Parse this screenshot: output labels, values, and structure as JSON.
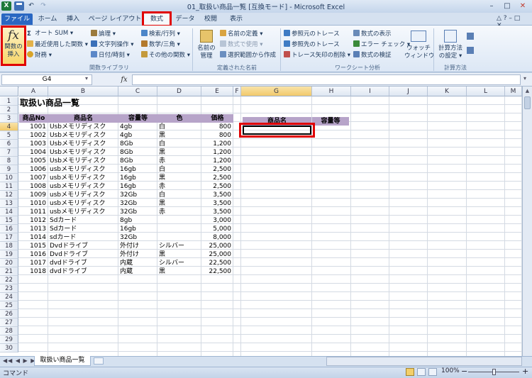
{
  "window": {
    "title": "01_取扱い商品一覧 [互換モード] - Microsoft Excel",
    "app_icon": "X",
    "undo": "↶",
    "redo": "↷"
  },
  "tabs": [
    "ファイル",
    "ホーム",
    "挿入",
    "ページ レイアウト",
    "数式",
    "データ",
    "校閲",
    "表示"
  ],
  "ribbon": {
    "insert_function": {
      "symbol": "fx",
      "line1": "関数の",
      "line2": "挿入"
    },
    "library": [
      "オート SUM",
      "最近使用した関数",
      "財務",
      "論理",
      "文字列操作",
      "日付/時刻",
      "検索/行列",
      "数学/三角",
      "その他の関数"
    ],
    "library_label": "関数ライブラリ",
    "name_manager": {
      "line1": "名前の",
      "line2": "管理"
    },
    "defined": [
      "名前の定義",
      "数式で使用",
      "選択範囲から作成"
    ],
    "defined_label": "定義された名前",
    "audit": [
      "参照元のトレース",
      "参照先のトレース",
      "トレース矢印の削除",
      "数式の表示",
      "エラー チェック",
      "数式の検証"
    ],
    "watch": {
      "line1": "ウォッチ",
      "line2": "ウィンドウ"
    },
    "audit_label": "ワークシート分析",
    "calc": {
      "line1": "計算方法",
      "line2": "の設定"
    },
    "calc_label": "計算方法"
  },
  "formula_bar": {
    "name_box": "G4",
    "fx": "fx",
    "value": ""
  },
  "columns": [
    "A",
    "B",
    "C",
    "D",
    "E",
    "F",
    "G",
    "H",
    "I",
    "J",
    "K",
    "L",
    "M"
  ],
  "rows": [
    "1",
    "2",
    "3",
    "4",
    "5",
    "6",
    "7",
    "8",
    "9",
    "10",
    "11",
    "12",
    "13",
    "14",
    "15",
    "16",
    "17",
    "18",
    "19",
    "20",
    "21",
    "22",
    "23",
    "24",
    "25",
    "26",
    "27",
    "28",
    "29",
    "30"
  ],
  "sheet": {
    "title": "取扱い商品一覧",
    "headers": [
      "商品No",
      "商品名",
      "容量等",
      "色",
      "価格"
    ],
    "lookup_headers": [
      "商品名",
      "容量等"
    ],
    "products": [
      [
        "1001",
        "Usbメモリディスク",
        "4gb",
        "白",
        "800"
      ],
      [
        "1002",
        "Usbメモリディスク",
        "4gb",
        "黒",
        "800"
      ],
      [
        "1003",
        "Usbメモリディスク",
        "8Gb",
        "白",
        "1,200"
      ],
      [
        "1004",
        "Usbメモリディスク",
        "8Gb",
        "黒",
        "1,200"
      ],
      [
        "1005",
        "Usbメモリディスク",
        "8Gb",
        "赤",
        "1,200"
      ],
      [
        "1006",
        "usbメモリディスク",
        "16gb",
        "白",
        "2,500"
      ],
      [
        "1007",
        "usbメモリディスク",
        "16gb",
        "黒",
        "2,500"
      ],
      [
        "1008",
        "usbメモリディスク",
        "16gb",
        "赤",
        "2,500"
      ],
      [
        "1009",
        "usbメモリディスク",
        "32Gb",
        "白",
        "3,500"
      ],
      [
        "1010",
        "usbメモリディスク",
        "32Gb",
        "黒",
        "3,500"
      ],
      [
        "1011",
        "usbメモリディスク",
        "32Gb",
        "赤",
        "3,500"
      ],
      [
        "1012",
        "Sdカード",
        "8gb",
        "",
        "3,000"
      ],
      [
        "1013",
        "Sdカード",
        "16gb",
        "",
        "5,000"
      ],
      [
        "1014",
        "sdカード",
        "32Gb",
        "",
        "8,000"
      ],
      [
        "1015",
        "Dvdドライブ",
        "外付け",
        "シルバー",
        "25,000"
      ],
      [
        "1016",
        "Dvdドライブ",
        "外付け",
        "黒",
        "25,000"
      ],
      [
        "1017",
        "dvdドライブ",
        "内蔵",
        "シルバー",
        "22,500"
      ],
      [
        "1018",
        "dvdドライブ",
        "内蔵",
        "黒",
        "22,500"
      ]
    ]
  },
  "sheet_tab": "取扱い商品一覧",
  "status": {
    "mode": "コマンド",
    "zoom": "100%",
    "minus": "−",
    "plus": "+"
  },
  "colors": {
    "header_fill": "#b7a4c9",
    "highlight": "#e00000",
    "file_tab": "#2a67c2"
  }
}
